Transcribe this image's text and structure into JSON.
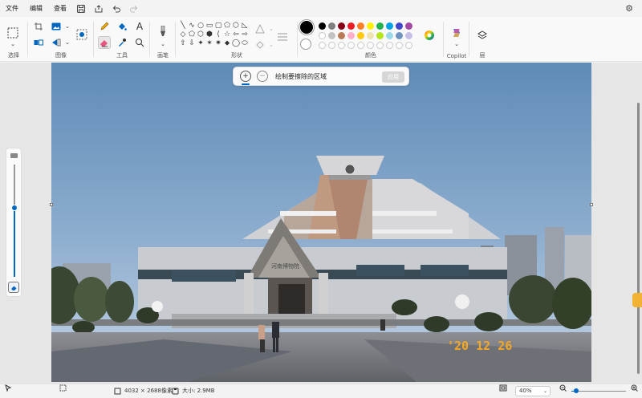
{
  "menu": {
    "file": "文件",
    "edit": "编辑",
    "view": "查看"
  },
  "quick_access": [
    "save-icon",
    "share-icon",
    "undo-icon",
    "redo-icon"
  ],
  "ribbon": {
    "selection_label": "选择",
    "image_label": "图像",
    "tools_label": "工具",
    "brushes_label": "画笔",
    "shapes_label": "形状",
    "colors_label": "颜色",
    "copilot_label": "Copilot",
    "layers_label": "层",
    "text_tool": "A"
  },
  "shapes": [
    "╲",
    "∿",
    "○",
    "▭",
    "▢",
    "⬠",
    "⬡",
    "◺",
    "◇",
    "⬠",
    "⬡",
    "⬢",
    "⟨",
    "☆",
    "⇦",
    "⇨",
    "⇧",
    "⇩",
    "✦",
    "✶",
    "✷",
    "⬥",
    "◯",
    "⬭"
  ],
  "colors": {
    "current_primary": "#000000",
    "current_secondary": "#ffffff",
    "row1": [
      "#000000",
      "#7f7f7f",
      "#880015",
      "#ed1c24",
      "#ff7f27",
      "#fff200",
      "#22b14c",
      "#00a2e8",
      "#3f48cc",
      "#a349a4"
    ],
    "row2": [
      "#ffffff",
      "#c3c3c3",
      "#b97a57",
      "#ffaec9",
      "#ffc90e",
      "#efe4b0",
      "#b5e61d",
      "#99d9ea",
      "#7092be",
      "#c8bfe7"
    ],
    "row3": [
      "empty",
      "empty",
      "empty",
      "empty",
      "empty",
      "empty",
      "empty",
      "empty",
      "empty",
      "empty"
    ],
    "accent": "#0067c0"
  },
  "erase_bar": {
    "hint": "绘制要擦除的区域",
    "apply": "应用"
  },
  "photo": {
    "date_stamp": "'20 12 26",
    "museum_sign": "河南博物院"
  },
  "status": {
    "dimensions": "4032 × 2688像素",
    "file_size": "大小: 2.9MB",
    "zoom": "40%"
  }
}
